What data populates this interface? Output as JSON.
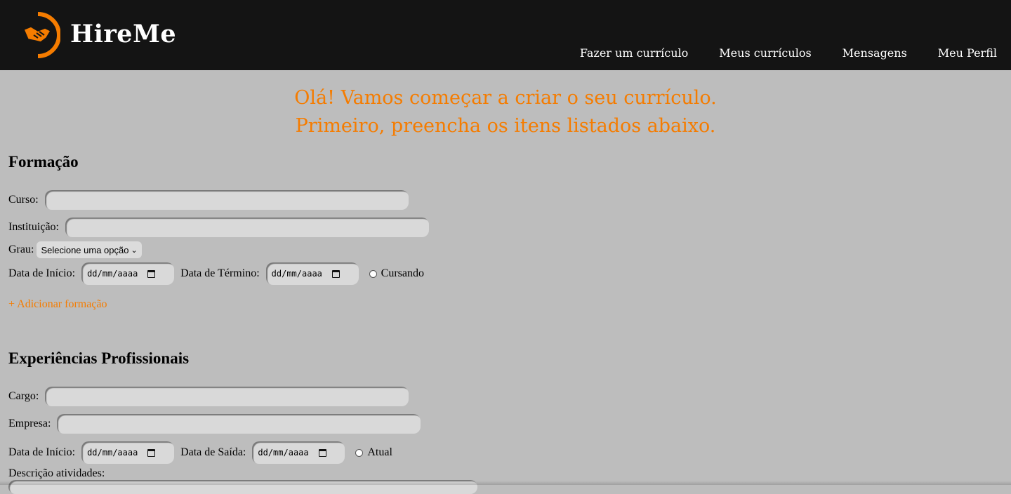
{
  "header": {
    "brand": "HireMe",
    "nav": [
      "Fazer um currículo",
      "Meus currículos",
      "Mensagens",
      "Meu Perfil"
    ]
  },
  "hero": {
    "line1": "Olá! Vamos começar a criar o seu currículo.",
    "line2": "Primeiro, preencha os itens listados abaixo."
  },
  "formacao": {
    "title": "Formação",
    "curso_label": "Curso:",
    "instituicao_label": "Instituição:",
    "grau_label": "Grau:",
    "grau_value": "Selecione uma opção",
    "inicio_label": "Data de Início:",
    "inicio_placeholder": "dd/mm/aaaa",
    "termino_label": "Data de Término:",
    "termino_placeholder": "dd/mm/aaaa",
    "cursando_label": "Cursando",
    "add_label": "+ Adicionar formação"
  },
  "experiencias": {
    "title": "Experiências Profissionais",
    "cargo_label": "Cargo:",
    "empresa_label": "Empresa:",
    "inicio_label": "Data de Início:",
    "inicio_placeholder": "dd/mm/aaaa",
    "saida_label": "Data de Saída:",
    "saida_placeholder": "dd/mm/aaaa",
    "atual_label": "Atual",
    "descricao_label": "Descrição atividades:"
  },
  "colors": {
    "header_bg": "#141414",
    "accent": "#f57c00",
    "page_bg": "#bdbdbd",
    "input_bg": "#d9d9d9"
  },
  "icons": {
    "logo": "handshake-icon",
    "date": "calendar-icon",
    "select": "chevron-down-icon"
  }
}
